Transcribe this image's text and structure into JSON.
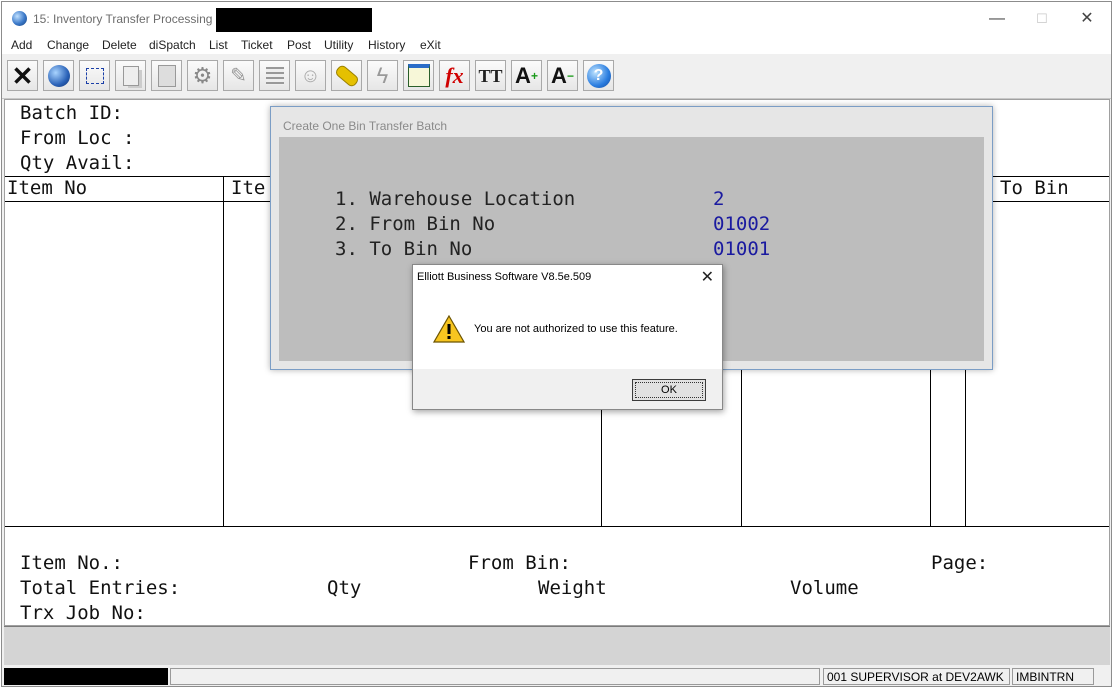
{
  "window": {
    "title": "15: Inventory Transfer Processing -",
    "controls": {
      "minimize": "—",
      "maximize": "☐",
      "close": "✕"
    }
  },
  "menu": [
    "Add",
    "Change",
    "Delete",
    "diSpatch",
    "List",
    "Ticket",
    "Post",
    "Utility",
    "History",
    "eXit"
  ],
  "toolbar": [
    "cancel-icon",
    "globe-icon",
    "select-icon",
    "copy-icon",
    "paste-icon",
    "settings-icon",
    "edit-icon",
    "list-icon",
    "users-icon",
    "link-icon",
    "lightning-icon",
    "calendar-icon",
    "function-icon",
    "font-icon",
    "font-larger-icon",
    "font-smaller-icon",
    "help-icon"
  ],
  "screen": {
    "batch_id": "Batch ID:",
    "from_loc": "From Loc :",
    "qty_avail": "Qty Avail:",
    "col_item_no": "Item No",
    "col_item_desc": "Ite",
    "col_to_bin": "To Bin",
    "item_no_footer": "Item No.:",
    "from_bin": "From Bin:",
    "page": "Page:",
    "total_entries": "Total Entries:",
    "qty": "Qty",
    "weight": "Weight",
    "volume": "Volume",
    "trx_job_no": "Trx Job No:"
  },
  "batch_dialog": {
    "title": "Create One Bin Transfer Batch",
    "fields": [
      {
        "label": "1. Warehouse Location",
        "value": "2"
      },
      {
        "label": "2. From Bin No",
        "value": "01002"
      },
      {
        "label": "3. To Bin No",
        "value": "01001"
      }
    ]
  },
  "alert": {
    "title": "Elliott Business Software V8.5e.509",
    "message": "You are not authorized to use this feature.",
    "ok": "OK",
    "close": "✕",
    "icon": "warning-icon"
  },
  "status": {
    "user": "001 SUPERVISOR at DEV2AWK",
    "program": "IMBINTRN"
  }
}
